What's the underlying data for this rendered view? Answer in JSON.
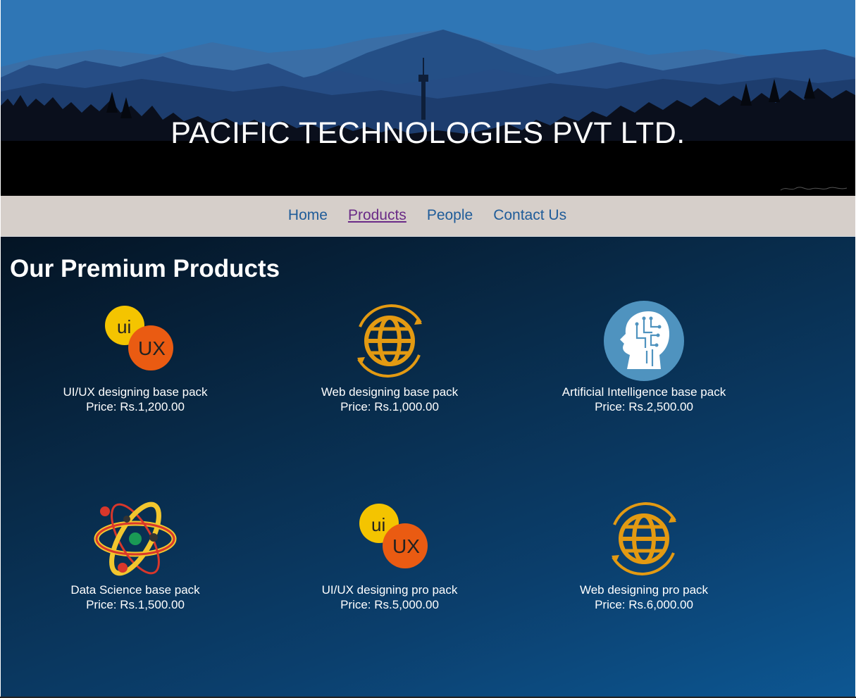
{
  "header": {
    "title": "PACIFIC TECHNOLOGIES PVT LTD."
  },
  "nav": {
    "items": [
      {
        "label": "Home",
        "active": false
      },
      {
        "label": "Products",
        "active": true
      },
      {
        "label": "People",
        "active": false
      },
      {
        "label": "Contact Us",
        "active": false
      }
    ]
  },
  "main": {
    "title": "Our Premium Products",
    "products": [
      {
        "name": "UI/UX designing base pack",
        "price": "Price: Rs.1,200.00",
        "icon": "ui-ux-icon"
      },
      {
        "name": "Web designing base pack",
        "price": "Price: Rs.1,000.00",
        "icon": "globe-icon"
      },
      {
        "name": "Artificial Intelligence base pack",
        "price": "Price: Rs.2,500.00",
        "icon": "ai-head-icon"
      },
      {
        "name": "Data Science base pack",
        "price": "Price: Rs.1,500.00",
        "icon": "atom-icon"
      },
      {
        "name": "UI/UX designing pro pack",
        "price": "Price: Rs.5,000.00",
        "icon": "ui-ux-icon"
      },
      {
        "name": "Web designing pro pack",
        "price": "Price: Rs.6,000.00",
        "icon": "globe-icon"
      }
    ]
  },
  "colors": {
    "hero_sky": "#2f76b5",
    "nav_bg": "#d6cfca",
    "nav_link": "#1f5c99",
    "nav_active": "#6a2b87",
    "main_bg_dark": "#041424",
    "main_bg_light": "#0d5793"
  }
}
